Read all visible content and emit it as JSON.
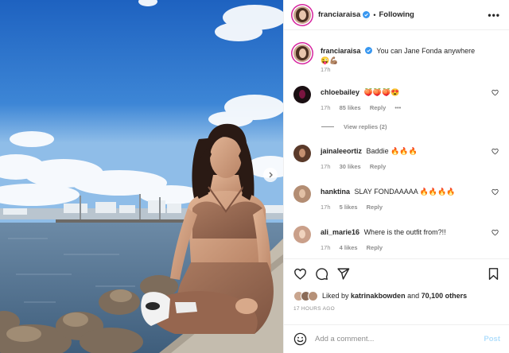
{
  "post": {
    "author": "franciaraisa",
    "following_label": "Following",
    "more_label": "•••",
    "caption": {
      "username": "franciaraisa",
      "text": "You can Jane Fonda anywhere 😜💪🏽",
      "time": "17h"
    },
    "comments": [
      {
        "username": "chloebailey",
        "text": "🍑🍑🍑😍",
        "time": "17h",
        "likes": "85 likes",
        "reply": "Reply",
        "options": "•••",
        "view_replies": "View replies (2)"
      },
      {
        "username": "jainaleeortiz",
        "text": "Baddie 🔥🔥🔥",
        "time": "17h",
        "likes": "30 likes",
        "reply": "Reply"
      },
      {
        "username": "hanktina",
        "text": "SLAY FONDAAAAA 🔥🔥🔥🔥",
        "time": "17h",
        "likes": "5 likes",
        "reply": "Reply"
      },
      {
        "username": "ali_marie16",
        "text": "Where is the outfit from?!!",
        "time": "17h",
        "likes": "4 likes",
        "reply": "Reply"
      }
    ],
    "likes": {
      "prefix": "Liked by",
      "user": "katrinakbowden",
      "middle": "and",
      "count": "70,100 others"
    },
    "timestamp": "17 HOURS AGO",
    "add_comment": {
      "placeholder": "Add a comment...",
      "post_label": "Post"
    },
    "colors": {
      "accent": "#0095f6",
      "verified": "#3897f0",
      "post_disabled": "#b2dffc",
      "secondary_text": "#8e8e8e"
    }
  }
}
